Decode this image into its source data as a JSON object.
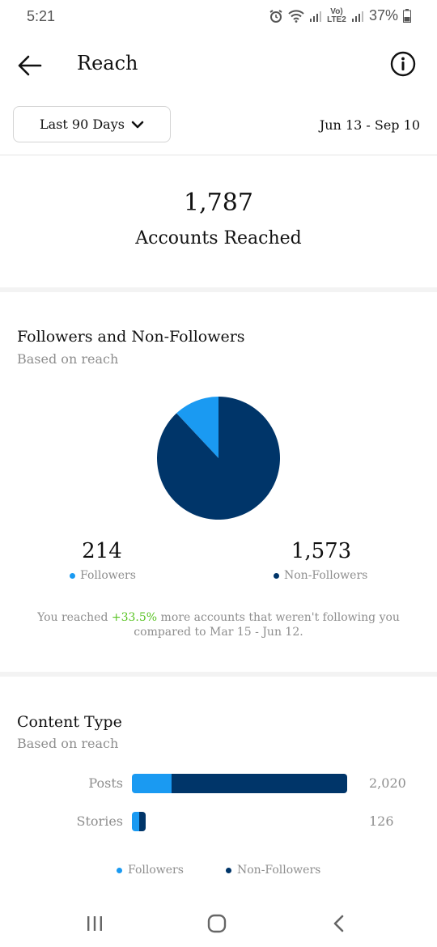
{
  "status_bar": {
    "time": "5:21",
    "network_label": "Vo) LTE2",
    "battery": "37%"
  },
  "header": {
    "title": "Reach",
    "back_icon": "arrow-left-icon",
    "info_icon": "info-circle-icon"
  },
  "filters": {
    "range_label": "Last 90 Days",
    "date_range": "Jun 13 - Sep 10"
  },
  "summary": {
    "total": "1,787",
    "label": "Accounts Reached"
  },
  "followers_section": {
    "title": "Followers and Non-Followers",
    "subtitle": "Based on reach",
    "followers_value": "214",
    "followers_label": "Followers",
    "nonfollowers_value": "1,573",
    "nonfollowers_label": "Non-Followers",
    "compare_prefix": "You reached ",
    "compare_pct": "+33.5%",
    "compare_suffix": " more accounts that weren't following you compared to Mar 15 - Jun 12."
  },
  "content_section": {
    "title": "Content Type",
    "subtitle": "Based on reach",
    "legend_followers": "Followers",
    "legend_nonfollowers": "Non-Followers"
  },
  "colors": {
    "followers": "#1a9af2",
    "nonfollowers": "#003569",
    "positive": "#58c322"
  },
  "chart_data": [
    {
      "type": "pie",
      "title": "Followers and Non-Followers",
      "categories": [
        "Followers",
        "Non-Followers"
      ],
      "values": [
        214,
        1573
      ]
    },
    {
      "type": "bar",
      "title": "Content Type",
      "categories": [
        "Posts",
        "Stories"
      ],
      "totals": [
        "2,020",
        "126"
      ],
      "series": [
        {
          "name": "Followers",
          "values": [
            370,
            70
          ]
        },
        {
          "name": "Non-Followers",
          "values": [
            1650,
            56
          ]
        }
      ],
      "xlim": [
        0,
        2020
      ]
    }
  ]
}
